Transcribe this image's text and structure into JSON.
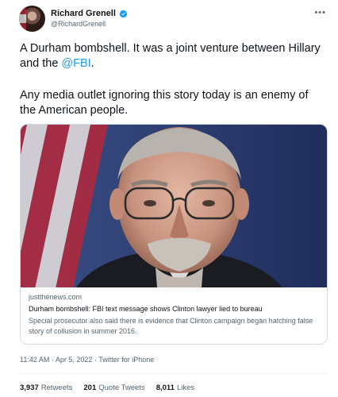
{
  "author": {
    "name": "Richard Grenell",
    "handle": "@RichardGrenell"
  },
  "tweet": {
    "line1": "A Durham bombshell. It was a joint venture between Hillary and the ",
    "mention": "@FBI",
    "line1_end": ".",
    "line2": "Any media outlet ignoring this story today is an enemy of the American people."
  },
  "card": {
    "domain": "justthenews.com",
    "title": "Durham bombshell: FBI text message shows Clinton lawyer lied to bureau",
    "description": "Special prosecutor also said there is evidence that Clinton campaign began hatching false story of collusion in summer 2016."
  },
  "meta": {
    "timestamp": "11:42 AM · Apr 5, 2022 · Twitter for iPhone"
  },
  "stats": {
    "retweets_count": "3,937",
    "retweets_label": "Retweets",
    "quotes_count": "201",
    "quotes_label": "Quote Tweets",
    "likes_count": "8,011",
    "likes_label": "Likes"
  },
  "colors": {
    "accent": "#1d9bf0",
    "text": "#0f1419",
    "secondary": "#536471"
  },
  "icons": {
    "more": "more-icon",
    "verified": "verified-badge-icon"
  }
}
